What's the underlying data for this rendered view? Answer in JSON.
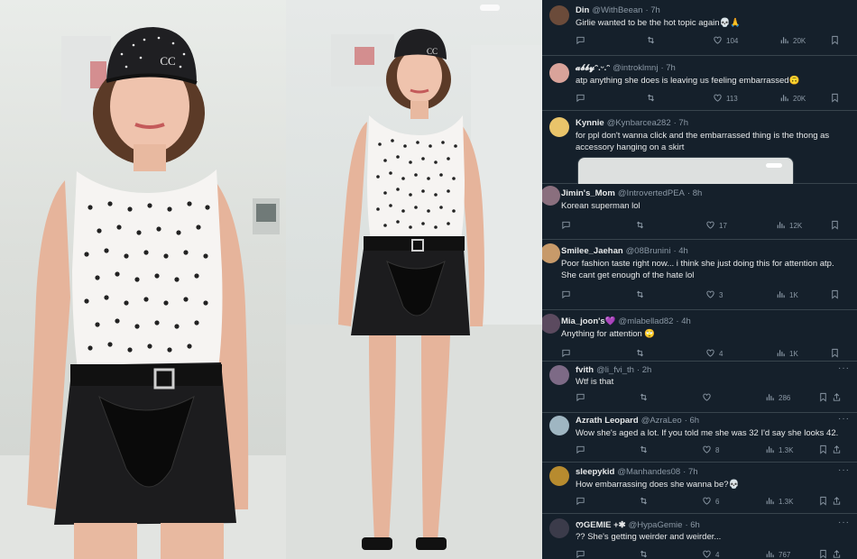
{
  "colors": {
    "feed_bg": "#15202b",
    "text": "#e7e9ea",
    "muted": "#8b98a5",
    "divider": "#38444d"
  },
  "icons": [
    "reply-icon",
    "retweet-icon",
    "like-icon",
    "views-icon",
    "bookmark-icon",
    "share-icon",
    "more-icon"
  ],
  "tweets": [
    {
      "name": "Din",
      "handle": "@WithBeean",
      "time": "· 7h",
      "text": "Girlie wanted to be the hot topic again💀🙏",
      "likes": "104",
      "views": "20K",
      "avatar_color": "#6b4b3a"
    },
    {
      "name": "𝓪𝓫𝓫𝔂ᵔ.ᵕ.ᵔ",
      "handle": "@introklmnj",
      "time": "· 7h",
      "text": "atp anything she does is leaving us feeling embarrassed🙃",
      "likes": "113",
      "views": "20K",
      "avatar_color": "#d9a39a"
    },
    {
      "name": "Kynnie",
      "handle": "@Kynbarcea282",
      "time": "· 7h",
      "text": "for ppl don't wanna click and the embarrassed thing is the thong as accessory hanging on a skirt",
      "avatar_color": "#e9c46a"
    },
    {
      "name": "Jimin's_Mom",
      "handle": "@IntrovertedPEA",
      "time": "· 8h",
      "text": "Korean superman lol",
      "likes": "17",
      "views": "12K",
      "avatar_color": "#8a6f7e"
    },
    {
      "name": "Smilee_Jaehan",
      "handle": "@08Brunini",
      "time": "· 4h",
      "text": "Poor fashion taste right now... i think she just doing this for attention atp. She cant get enough of the hate lol",
      "likes": "3",
      "views": "1K",
      "avatar_color": "#c79a6a"
    },
    {
      "name": "Mia_joon's💜",
      "handle": "@mlabellad82",
      "time": "· 4h",
      "text": "Anything for attention 🙄",
      "likes": "4",
      "views": "1K",
      "avatar_color": "#5b4a5f"
    },
    {
      "name": "fvith",
      "handle": "@li_fvi_th",
      "time": "· 2h",
      "text": "Wtf is that",
      "views": "286",
      "avatar_color": "#7d6a86"
    },
    {
      "name": "Azrath Leopard",
      "handle": "@AzraLeo",
      "time": "· 6h",
      "text": "Wow she's aged a lot. If you told me she was 32 I'd say she looks 42.",
      "likes": "8",
      "views": "1.3K",
      "avatar_color": "#9fb6c2"
    },
    {
      "name": "sleepykid",
      "handle": "@Manhandes08",
      "time": "· 7h",
      "text": "How embarrassing does she wanna be?💀",
      "likes": "6",
      "views": "1.3K",
      "avatar_color": "#b78b2f"
    },
    {
      "name": "ᰔGEMIE +✱",
      "handle": "@HypaGemie",
      "time": "· 6h",
      "text": "?? She's getting weirder and weirder...",
      "likes": "4",
      "views": "767",
      "avatar_color": "#3b3b4a"
    }
  ]
}
